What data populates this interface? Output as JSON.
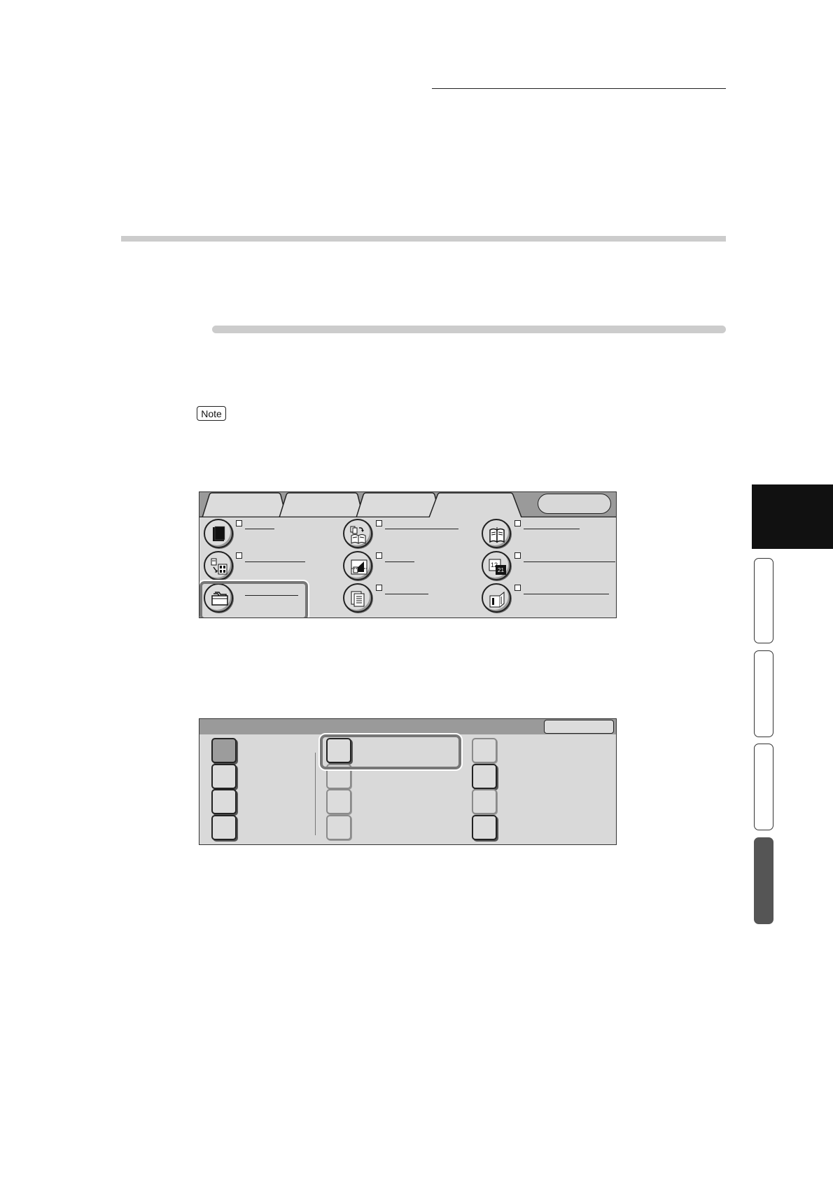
{
  "note": {
    "label": "Note"
  },
  "colors": {
    "panel_bg": "#d9d9d9",
    "tab_strip": "#9a9a9a",
    "highlight_frame": "#777777",
    "side_tab_active": "#555555"
  },
  "screen1": {
    "features": [
      {
        "icon": "single-sheet-icon"
      },
      {
        "icon": "book-copy-icon"
      },
      {
        "icon": "booklet-icon"
      },
      {
        "icon": "multi-up-icon"
      },
      {
        "icon": "image-shift-icon"
      },
      {
        "icon": "page-number-icon"
      },
      {
        "icon": "folder-icon",
        "highlighted": true
      },
      {
        "icon": "stacked-pages-icon"
      },
      {
        "icon": "poster-icon"
      }
    ]
  },
  "screen2": {
    "columns": [
      {
        "buttons": 4,
        "selected_index": 0
      },
      {
        "buttons": 4,
        "highlighted_index": 0
      },
      {
        "buttons": 4
      }
    ]
  }
}
